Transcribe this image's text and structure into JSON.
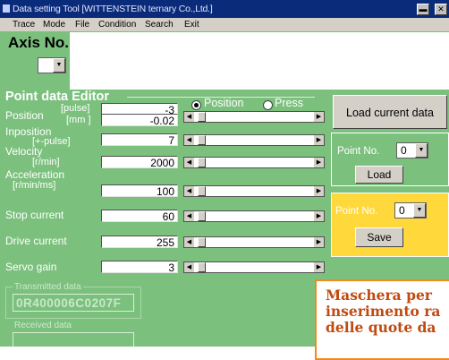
{
  "window": {
    "title": "Data setting Tool [WITTENSTEIN ternary Co.,Ltd.]",
    "minimize_glyph": "▬",
    "close_glyph": "✕"
  },
  "menu": [
    "Trace",
    "Mode",
    "File",
    "Condition",
    "Search",
    "Exit"
  ],
  "axis": {
    "title": "Axis No.",
    "value": ""
  },
  "editor": {
    "title": "Point data Editor",
    "mode_options": [
      {
        "label": "Position",
        "selected": true
      },
      {
        "label": "Press",
        "selected": false
      }
    ],
    "rows": [
      {
        "label": "Position",
        "unit": "[pulse]",
        "value": "-3",
        "slider": 0.02
      },
      {
        "label": "",
        "unit": "[mm ]",
        "value": "-0.02",
        "slider": null
      },
      {
        "label": "Inposition",
        "unit": "[+-pulse]",
        "value": "7",
        "slider": 0.02
      },
      {
        "label": "Velocity",
        "unit": "[r/min]",
        "value": "2000",
        "slider": 0.02
      },
      {
        "label": "Acceleration",
        "unit": "[r/min/ms]",
        "value": "100",
        "slider": 0.02
      },
      {
        "label": "Stop current",
        "unit": "",
        "value": "60",
        "slider": 0.02
      },
      {
        "label": "Drive current",
        "unit": "",
        "value": "255",
        "slider": 0.02
      },
      {
        "label": "Servo gain",
        "unit": "",
        "value": "3",
        "slider": 0.02
      }
    ]
  },
  "load_current_button": "Load current data",
  "load_panel": {
    "point_label": "Point No.",
    "point_value": "0",
    "button": "Load"
  },
  "save_panel": {
    "point_label": "Point No.",
    "point_value": "0",
    "button": "Save"
  },
  "transmitted": {
    "title": "Transmitted data",
    "value": "0R400006C0207F"
  },
  "received": {
    "title": "Received data",
    "value": ""
  },
  "callout": {
    "line1": "Maschera per",
    "line2": "inserimento ra",
    "line3": "delle quote da"
  },
  "colors": {
    "window_bg": "#7cc07e",
    "titlebar": "#0a2a7a",
    "save_panel": "#ffd83c",
    "callout_border": "#f08a1c",
    "callout_text": "#c04a10"
  }
}
